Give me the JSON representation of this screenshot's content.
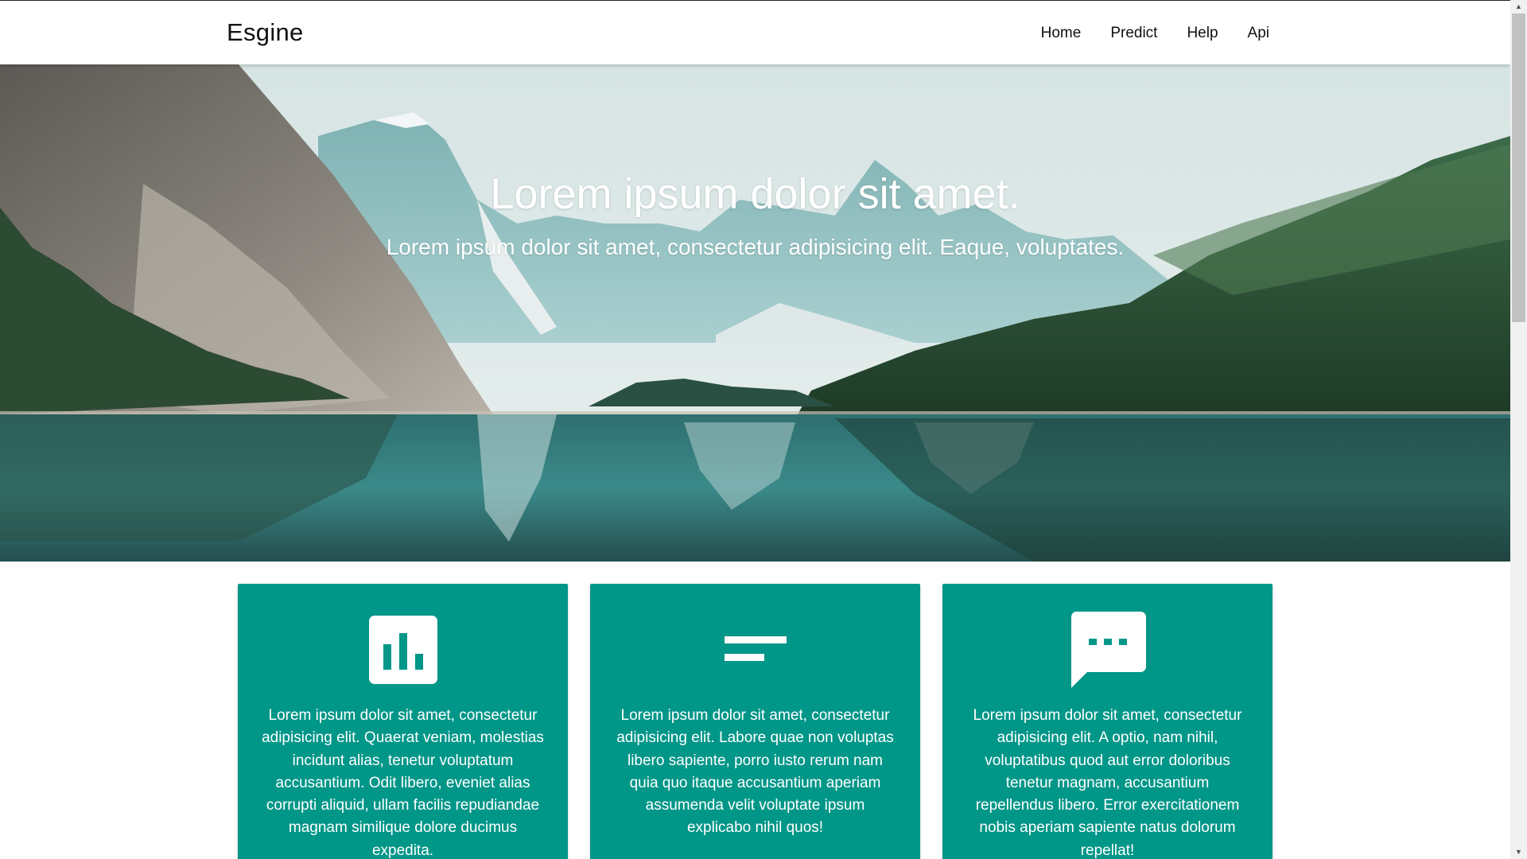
{
  "navbar": {
    "brand": "Esgine",
    "links": [
      {
        "label": "Home"
      },
      {
        "label": "Predict"
      },
      {
        "label": "Help"
      },
      {
        "label": "Api"
      }
    ]
  },
  "hero": {
    "title": "Lorem ipsum dolor sit amet.",
    "subtitle": "Lorem ipsum dolor sit amet, consectetur adipisicing elit. Eaque, voluptates."
  },
  "cards": [
    {
      "icon": "bar-chart-icon",
      "text": "Lorem ipsum dolor sit amet, consectetur adipisicing elit. Quaerat veniam, molestias incidunt alias, tenetur voluptatum accusantium. Odit libero, eveniet alias corrupti aliquid, ullam facilis repudiandae magnam similique dolore ducimus expedita."
    },
    {
      "icon": "short-text-icon",
      "text": "Lorem ipsum dolor sit amet, consectetur adipisicing elit. Labore quae non voluptas libero sapiente, porro iusto rerum nam quia quo itaque accusantium aperiam assumenda velit voluptate ipsum explicabo nihil quos!"
    },
    {
      "icon": "chat-bubble-icon",
      "text": "Lorem ipsum dolor sit amet, consectetur adipisicing elit. A optio, nam nihil, voluptatibus quod aut error doloribus tenetur magnam, accusantium repellendus libero. Error exercitationem nobis aperiam sapiente natus dolorum repellat!"
    }
  ],
  "colors": {
    "card_background": "#009688",
    "navbar_background": "#ffffff",
    "text_on_accent": "#ffffff"
  }
}
